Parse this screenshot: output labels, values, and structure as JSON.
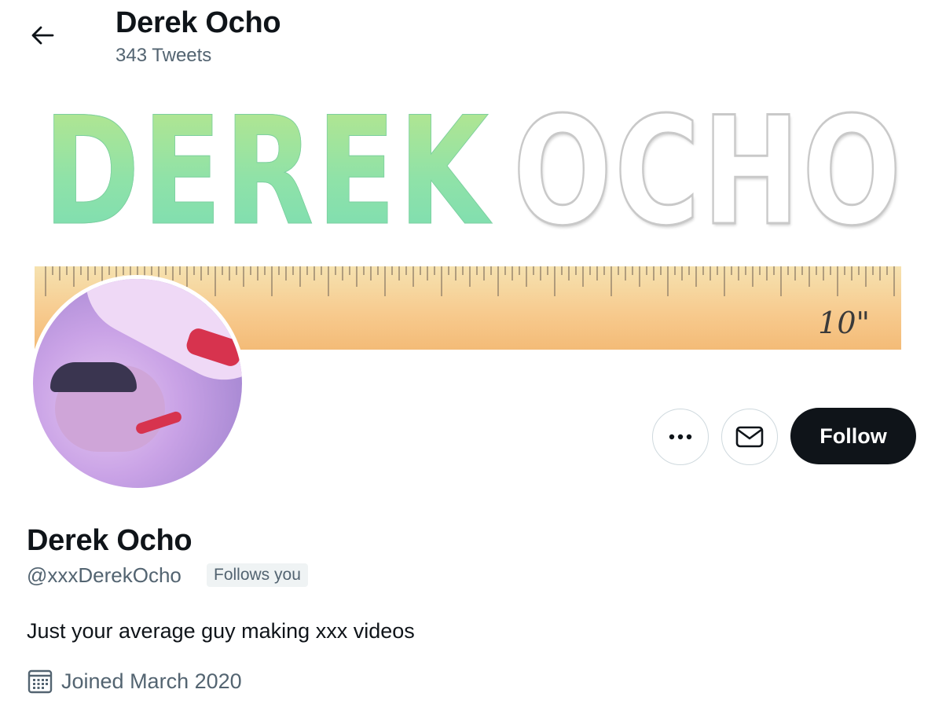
{
  "header": {
    "title": "Derek Ocho",
    "tweet_count": "343 Tweets"
  },
  "banner": {
    "word_left": "DEREK",
    "word_right": "OCHO",
    "ruler_label": "10\""
  },
  "profile": {
    "display_name": "Derek Ocho",
    "handle": "@xxxDerekOcho",
    "follows_you": "Follows you",
    "bio": "Just your average guy making xxx videos",
    "joined": "Joined March 2020"
  },
  "actions": {
    "more_icon": "more-horizontal-icon",
    "message_icon": "envelope-icon",
    "follow_label": "Follow"
  },
  "colors": {
    "text_primary": "#0f1419",
    "text_secondary": "#536471",
    "follow_bg": "#0f1419",
    "border": "#cfd9de"
  }
}
